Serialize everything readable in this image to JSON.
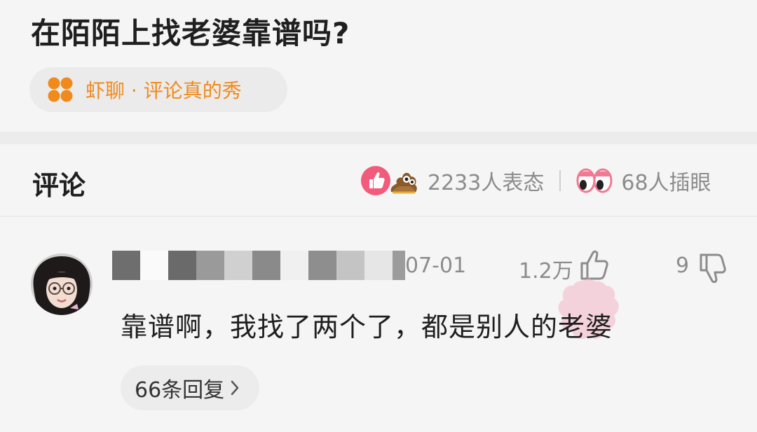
{
  "question": {
    "title": "在陌陌上找老婆靠谱吗?"
  },
  "topic": {
    "label": "虾聊 · 评论真的秀",
    "icon": "orange-clover-icon",
    "color": "#f08a1c"
  },
  "comments_section": {
    "heading": "评论",
    "reaction_count_text": "2233人表态",
    "reaction_icons": [
      "thumbs-up-emoji",
      "poop-face-emoji"
    ],
    "side_eye_count_text": "68人插眼",
    "side_eye_icon": "eyes-emoji"
  },
  "comment": {
    "username": "",
    "date": "07-01",
    "like_count": "1.2万",
    "dislike_count": "9",
    "text": "靠谱啊，我找了两个了，都是别人的老婆",
    "replies_label": "66条回复"
  }
}
